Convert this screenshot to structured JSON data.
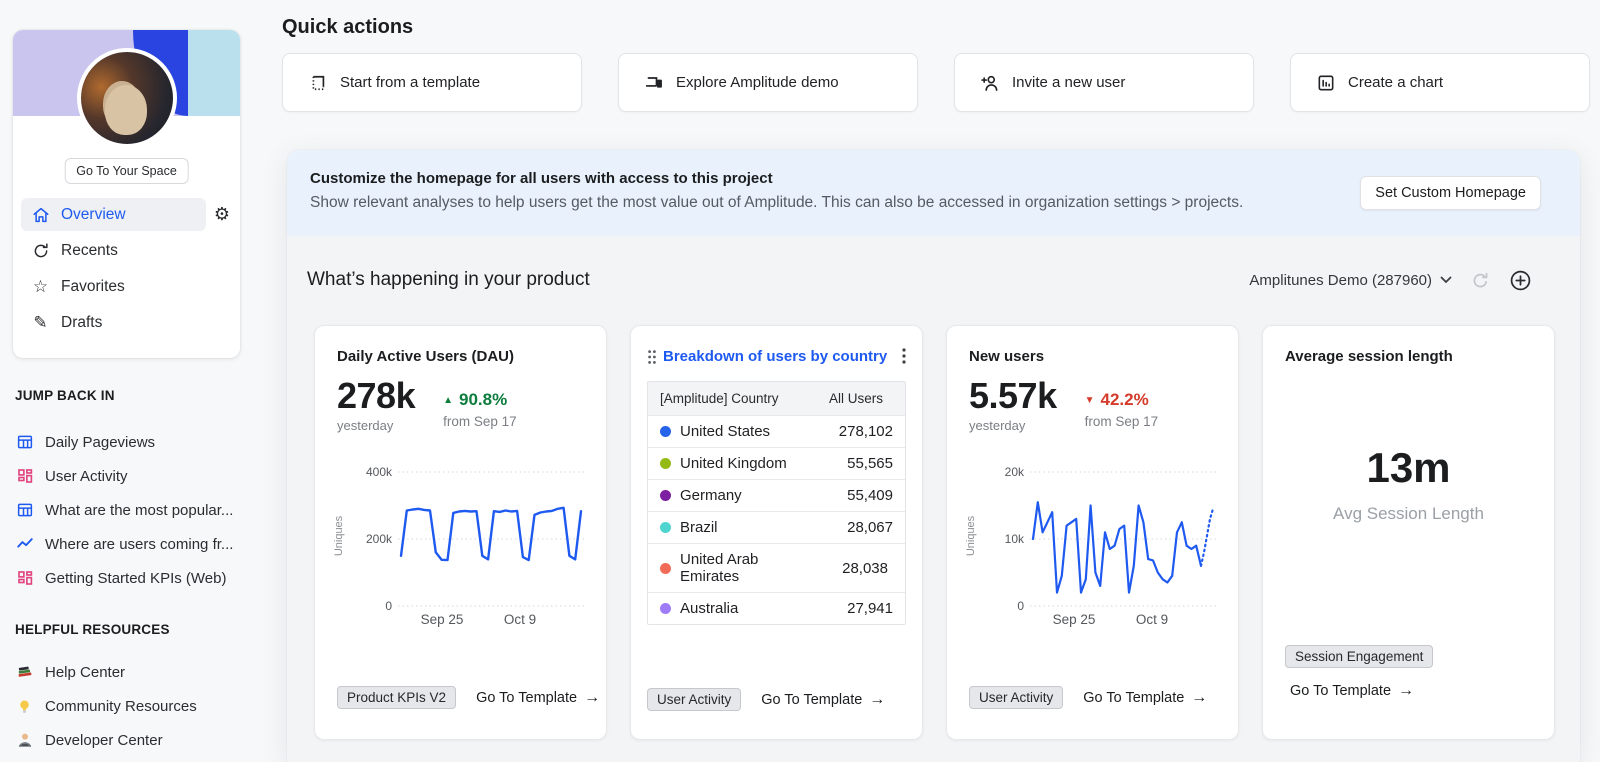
{
  "icons": {
    "arrow_right": "→",
    "triangle_up": "▲",
    "triangle_down": "▼",
    "gear": "⚙",
    "star": "☆",
    "pencil": "✎"
  },
  "colors": {
    "accent_blue": "#1f5af0",
    "positive_green": "#0d7d3d",
    "negative_red": "#d43b2a",
    "banner_bg": "#e8f1fc",
    "chart_line": "#1f5af0"
  },
  "sidebar": {
    "space_button": "Go To Your Space",
    "nav": [
      {
        "label": "Overview",
        "active": true
      },
      {
        "label": "Recents"
      },
      {
        "label": "Favorites"
      },
      {
        "label": "Drafts"
      }
    ],
    "jump_back_in": {
      "title": "JUMP BACK IN",
      "items": [
        {
          "label": "Daily Pageviews",
          "icon": "table-icon"
        },
        {
          "label": "User Activity",
          "icon": "dashboard-icon"
        },
        {
          "label": "What are the most popular...",
          "icon": "table-icon"
        },
        {
          "label": "Where are users coming fr...",
          "icon": "line-chart-icon"
        },
        {
          "label": "Getting Started KPIs (Web)",
          "icon": "dashboard-icon"
        }
      ]
    },
    "helpful_resources": {
      "title": "HELPFUL RESOURCES",
      "items": [
        {
          "label": "Help Center",
          "icon": "books-icon"
        },
        {
          "label": "Community Resources",
          "icon": "lightbulb-icon"
        },
        {
          "label": "Developer Center",
          "icon": "technologist-icon"
        }
      ]
    }
  },
  "quick_actions": {
    "title": "Quick actions",
    "buttons": [
      {
        "label": "Start from a template",
        "icon": "template-icon"
      },
      {
        "label": "Explore Amplitude demo",
        "icon": "devices-icon"
      },
      {
        "label": "Invite a new user",
        "icon": "add-user-icon"
      },
      {
        "label": "Create a chart",
        "icon": "bar-chart-icon"
      }
    ]
  },
  "banner": {
    "title": "Customize the homepage for all users with access to this project",
    "subtitle": "Show relevant analyses to help users get the most value out of Amplitude. This can also be accessed in organization settings > projects.",
    "button": "Set Custom Homepage"
  },
  "section": {
    "title": "What’s happening in your product",
    "project": "Amplitunes Demo (287960)"
  },
  "cards": {
    "dau": {
      "title": "Daily Active Users (DAU)",
      "value": "278k",
      "value_caption": "yesterday",
      "change": "90.8%",
      "change_direction": "up",
      "change_caption": "from Sep 17",
      "tag": "Product KPIs V2",
      "link": "Go To Template"
    },
    "country": {
      "title": "Breakdown of users by country",
      "tag": "User Activity",
      "link": "Go To Template"
    },
    "new_users": {
      "title": "New users",
      "value": "5.57k",
      "value_caption": "yesterday",
      "change": "42.2%",
      "change_direction": "down",
      "change_caption": "from Sep 17",
      "tag": "User Activity",
      "link": "Go To Template"
    },
    "session": {
      "title": "Average session length",
      "value": "13m",
      "caption": "Avg Session Length",
      "tag": "Session Engagement",
      "link": "Go To Template"
    }
  },
  "chart_data": [
    {
      "id": "dau",
      "type": "line",
      "title": "Daily Active Users (DAU)",
      "ylabel": "Uniques",
      "yticks": [
        "400k",
        "200k",
        "0"
      ],
      "xticks": [
        "Sep 25",
        "Oct 9"
      ],
      "ylim_k": [
        0,
        400
      ],
      "grid": true,
      "line_color": "#1f5af0",
      "values_k": [
        150,
        285,
        288,
        290,
        287,
        285,
        160,
        138,
        137,
        278,
        282,
        284,
        282,
        283,
        150,
        139,
        283,
        281,
        285,
        282,
        284,
        146,
        137,
        272,
        279,
        282,
        284,
        290,
        293,
        150,
        139,
        283
      ]
    },
    {
      "id": "country",
      "type": "table",
      "title": "Breakdown of users by country",
      "columns": [
        "[Amplitude] Country",
        "All Users"
      ],
      "rows": [
        {
          "name": "United States",
          "value": "278,102",
          "color": "#2563e8"
        },
        {
          "name": "United Kingdom",
          "value": "55,565",
          "color": "#94ba16"
        },
        {
          "name": "Germany",
          "value": "55,409",
          "color": "#7c1fa0"
        },
        {
          "name": "Brazil",
          "value": "28,067",
          "color": "#4fd4cf"
        },
        {
          "name": "United Arab Emirates",
          "value": "28,038",
          "color": "#f26a58"
        },
        {
          "name": "Australia",
          "value": "27,941",
          "color": "#9e7cf7"
        }
      ]
    },
    {
      "id": "new_users",
      "type": "line",
      "title": "New users",
      "ylabel": "Uniques",
      "yticks": [
        "20k",
        "10k",
        "0"
      ],
      "xticks": [
        "Sep 25",
        "Oct 9"
      ],
      "ylim_k": [
        0,
        20
      ],
      "grid": true,
      "line_color": "#1f5af0",
      "values_k": [
        10,
        15.5,
        11,
        12.5,
        14,
        2,
        4.5,
        12,
        12.5,
        13,
        2,
        4,
        15,
        5,
        3,
        11,
        8.5,
        9,
        11.5,
        12,
        2,
        6,
        15,
        12.5,
        7,
        6.8,
        5,
        4,
        3.5,
        4.5,
        11,
        12.5,
        9,
        8.5,
        9,
        6
      ],
      "forecast_k": [
        8,
        10.5,
        13,
        14.5
      ]
    },
    {
      "id": "session",
      "type": "stat",
      "value": "13m",
      "label": "Avg Session Length"
    }
  ]
}
